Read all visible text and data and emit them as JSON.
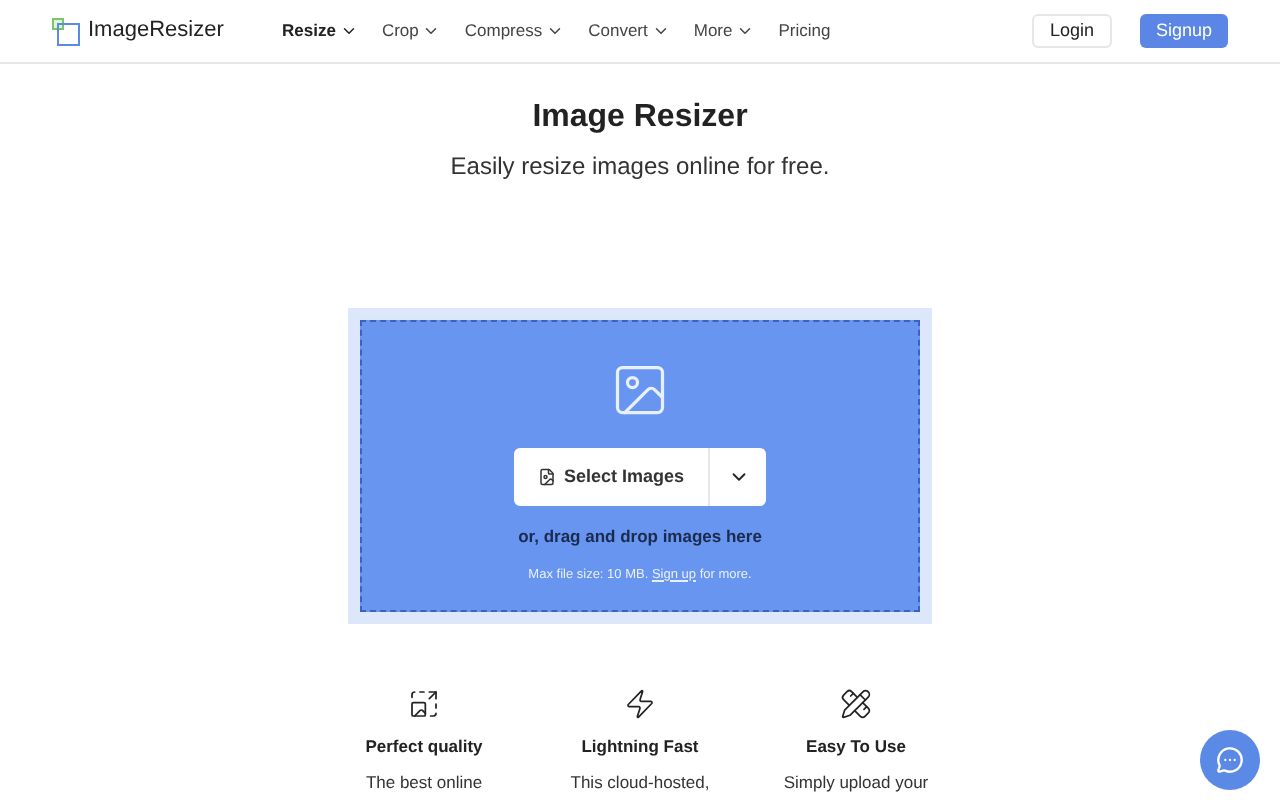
{
  "header": {
    "logo": "ImageResizer",
    "nav": [
      {
        "label": "Resize",
        "selected": true,
        "dropdown": true
      },
      {
        "label": "Crop",
        "selected": false,
        "dropdown": true
      },
      {
        "label": "Compress",
        "selected": false,
        "dropdown": true
      },
      {
        "label": "Convert",
        "selected": false,
        "dropdown": true
      },
      {
        "label": "More",
        "selected": false,
        "dropdown": true
      },
      {
        "label": "Pricing",
        "selected": false,
        "dropdown": false
      }
    ],
    "login": "Login",
    "signup": "Signup"
  },
  "hero": {
    "title": "Image Resizer",
    "subtitle": "Easily resize images online for free."
  },
  "dropzone": {
    "button": "Select Images",
    "hint": "or, drag and drop images here",
    "limit": "Max file size: 10 MB.",
    "link": "Sign up",
    "limit_suffix": "for more."
  },
  "features": [
    {
      "kind": "quality",
      "title": "Perfect quality",
      "text": "The best online"
    },
    {
      "kind": "fast",
      "title": "Lightning Fast",
      "text": "This cloud-hosted,"
    },
    {
      "kind": "easy",
      "title": "Easy To Use",
      "text": "Simply upload your"
    }
  ]
}
